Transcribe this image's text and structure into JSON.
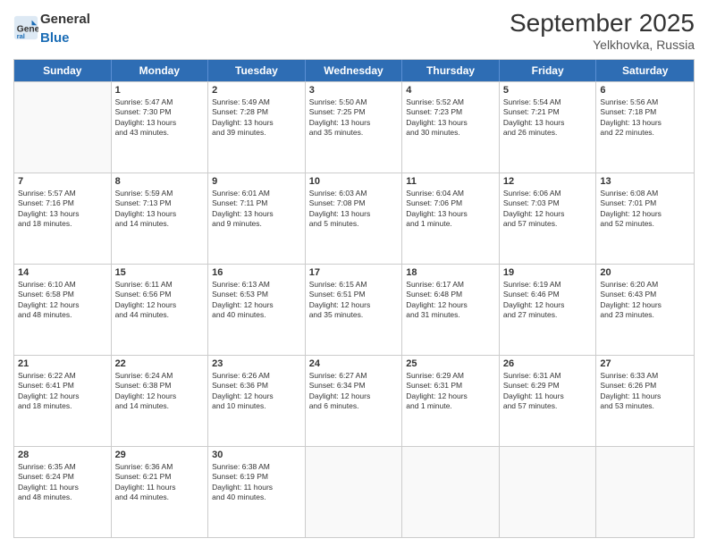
{
  "header": {
    "logo_general": "General",
    "logo_blue": "Blue",
    "month_title": "September 2025",
    "subtitle": "Yelkhovka, Russia"
  },
  "weekdays": [
    "Sunday",
    "Monday",
    "Tuesday",
    "Wednesday",
    "Thursday",
    "Friday",
    "Saturday"
  ],
  "rows": [
    [
      {
        "day": "",
        "text": ""
      },
      {
        "day": "1",
        "text": "Sunrise: 5:47 AM\nSunset: 7:30 PM\nDaylight: 13 hours\nand 43 minutes."
      },
      {
        "day": "2",
        "text": "Sunrise: 5:49 AM\nSunset: 7:28 PM\nDaylight: 13 hours\nand 39 minutes."
      },
      {
        "day": "3",
        "text": "Sunrise: 5:50 AM\nSunset: 7:25 PM\nDaylight: 13 hours\nand 35 minutes."
      },
      {
        "day": "4",
        "text": "Sunrise: 5:52 AM\nSunset: 7:23 PM\nDaylight: 13 hours\nand 30 minutes."
      },
      {
        "day": "5",
        "text": "Sunrise: 5:54 AM\nSunset: 7:21 PM\nDaylight: 13 hours\nand 26 minutes."
      },
      {
        "day": "6",
        "text": "Sunrise: 5:56 AM\nSunset: 7:18 PM\nDaylight: 13 hours\nand 22 minutes."
      }
    ],
    [
      {
        "day": "7",
        "text": "Sunrise: 5:57 AM\nSunset: 7:16 PM\nDaylight: 13 hours\nand 18 minutes."
      },
      {
        "day": "8",
        "text": "Sunrise: 5:59 AM\nSunset: 7:13 PM\nDaylight: 13 hours\nand 14 minutes."
      },
      {
        "day": "9",
        "text": "Sunrise: 6:01 AM\nSunset: 7:11 PM\nDaylight: 13 hours\nand 9 minutes."
      },
      {
        "day": "10",
        "text": "Sunrise: 6:03 AM\nSunset: 7:08 PM\nDaylight: 13 hours\nand 5 minutes."
      },
      {
        "day": "11",
        "text": "Sunrise: 6:04 AM\nSunset: 7:06 PM\nDaylight: 13 hours\nand 1 minute."
      },
      {
        "day": "12",
        "text": "Sunrise: 6:06 AM\nSunset: 7:03 PM\nDaylight: 12 hours\nand 57 minutes."
      },
      {
        "day": "13",
        "text": "Sunrise: 6:08 AM\nSunset: 7:01 PM\nDaylight: 12 hours\nand 52 minutes."
      }
    ],
    [
      {
        "day": "14",
        "text": "Sunrise: 6:10 AM\nSunset: 6:58 PM\nDaylight: 12 hours\nand 48 minutes."
      },
      {
        "day": "15",
        "text": "Sunrise: 6:11 AM\nSunset: 6:56 PM\nDaylight: 12 hours\nand 44 minutes."
      },
      {
        "day": "16",
        "text": "Sunrise: 6:13 AM\nSunset: 6:53 PM\nDaylight: 12 hours\nand 40 minutes."
      },
      {
        "day": "17",
        "text": "Sunrise: 6:15 AM\nSunset: 6:51 PM\nDaylight: 12 hours\nand 35 minutes."
      },
      {
        "day": "18",
        "text": "Sunrise: 6:17 AM\nSunset: 6:48 PM\nDaylight: 12 hours\nand 31 minutes."
      },
      {
        "day": "19",
        "text": "Sunrise: 6:19 AM\nSunset: 6:46 PM\nDaylight: 12 hours\nand 27 minutes."
      },
      {
        "day": "20",
        "text": "Sunrise: 6:20 AM\nSunset: 6:43 PM\nDaylight: 12 hours\nand 23 minutes."
      }
    ],
    [
      {
        "day": "21",
        "text": "Sunrise: 6:22 AM\nSunset: 6:41 PM\nDaylight: 12 hours\nand 18 minutes."
      },
      {
        "day": "22",
        "text": "Sunrise: 6:24 AM\nSunset: 6:38 PM\nDaylight: 12 hours\nand 14 minutes."
      },
      {
        "day": "23",
        "text": "Sunrise: 6:26 AM\nSunset: 6:36 PM\nDaylight: 12 hours\nand 10 minutes."
      },
      {
        "day": "24",
        "text": "Sunrise: 6:27 AM\nSunset: 6:34 PM\nDaylight: 12 hours\nand 6 minutes."
      },
      {
        "day": "25",
        "text": "Sunrise: 6:29 AM\nSunset: 6:31 PM\nDaylight: 12 hours\nand 1 minute."
      },
      {
        "day": "26",
        "text": "Sunrise: 6:31 AM\nSunset: 6:29 PM\nDaylight: 11 hours\nand 57 minutes."
      },
      {
        "day": "27",
        "text": "Sunrise: 6:33 AM\nSunset: 6:26 PM\nDaylight: 11 hours\nand 53 minutes."
      }
    ],
    [
      {
        "day": "28",
        "text": "Sunrise: 6:35 AM\nSunset: 6:24 PM\nDaylight: 11 hours\nand 48 minutes."
      },
      {
        "day": "29",
        "text": "Sunrise: 6:36 AM\nSunset: 6:21 PM\nDaylight: 11 hours\nand 44 minutes."
      },
      {
        "day": "30",
        "text": "Sunrise: 6:38 AM\nSunset: 6:19 PM\nDaylight: 11 hours\nand 40 minutes."
      },
      {
        "day": "",
        "text": ""
      },
      {
        "day": "",
        "text": ""
      },
      {
        "day": "",
        "text": ""
      },
      {
        "day": "",
        "text": ""
      }
    ]
  ]
}
